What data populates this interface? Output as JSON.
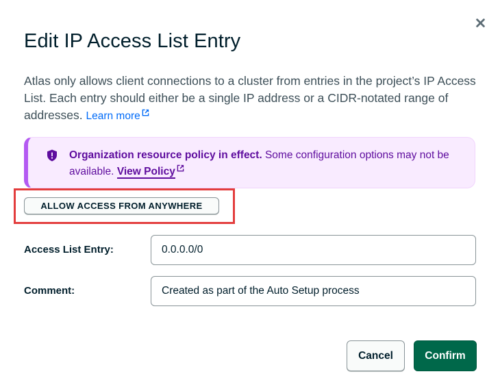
{
  "modal": {
    "title": "Edit IP Access List Entry",
    "description": "Atlas only allows client connections to a cluster from entries in the project’s IP Access List. Each entry should either be a single IP address or a CIDR-notated range of addresses.",
    "learn_more": "Learn more",
    "close_icon": "close-icon"
  },
  "banner": {
    "icon": "shield-icon",
    "bold_text": "Organization resource policy in effect.",
    "text": "Some configuration options may not be available.",
    "link": "View Policy",
    "colors": {
      "background": "#f9ebff",
      "accent": "#b45af2",
      "text": "#5e0c9e"
    }
  },
  "allow_anywhere_button": "ALLOW ACCESS FROM ANYWHERE",
  "form": {
    "access_list_entry": {
      "label": "Access List Entry:",
      "value": "0.0.0.0/0"
    },
    "comment": {
      "label": "Comment:",
      "value": "Created as part of the Auto Setup process"
    }
  },
  "footer": {
    "cancel": "Cancel",
    "confirm": "Confirm",
    "colors": {
      "confirm": "#00684a"
    }
  },
  "highlight_color": "#e33d3d"
}
